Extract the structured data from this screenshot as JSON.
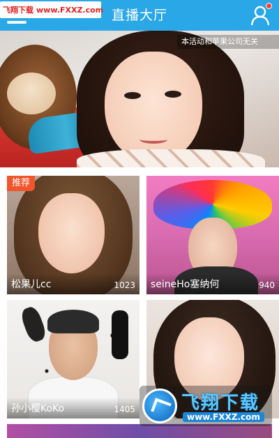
{
  "header": {
    "title": "直播大厅",
    "user_icon": "user-icon",
    "menu_icon": "menu-icon",
    "accent": "#2aa7e6"
  },
  "watermark_top": {
    "brand": "飞翔下载",
    "url": "www.FXXZ.com"
  },
  "banner": {
    "notice": "本活动和苹果公司无关",
    "slides": 4,
    "active_slide": 2
  },
  "rooms": [
    {
      "name": "松果儿cc",
      "viewers": "1023",
      "badge": "推荐"
    },
    {
      "name": "seineHo塞纳何",
      "viewers": "940",
      "badge": ""
    },
    {
      "name": "孙小樱KoKo",
      "viewers": "1405",
      "badge": ""
    },
    {
      "name": "",
      "viewers": "",
      "badge": ""
    }
  ],
  "watermark_bottom": {
    "brand": "飞翔下载",
    "url": "www.FXXZ.com"
  }
}
